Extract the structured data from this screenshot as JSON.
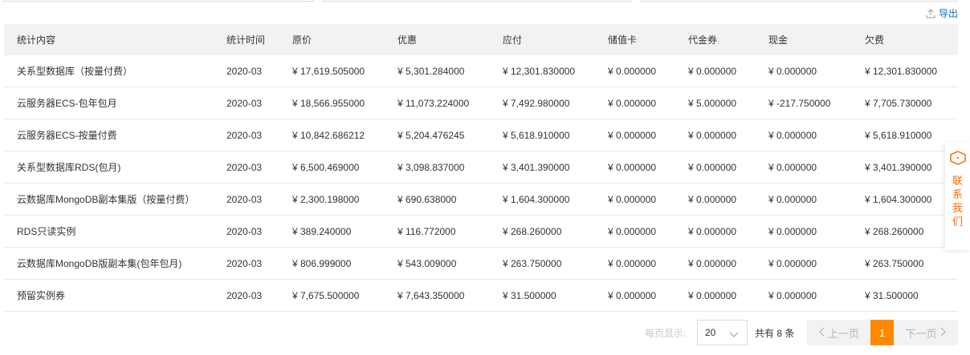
{
  "toolbar": {
    "export_label": "导出"
  },
  "table": {
    "headers": [
      "统计内容",
      "统计时间",
      "原价",
      "优惠",
      "应付",
      "储值卡",
      "代金券",
      "现金",
      "欠费"
    ],
    "rows": [
      [
        "关系型数据库（按量付费）",
        "2020-03",
        "¥ 17,619.505000",
        "¥ 5,301.284000",
        "¥ 12,301.830000",
        "¥ 0.000000",
        "¥ 0.000000",
        "¥ 0.000000",
        "¥ 12,301.830000"
      ],
      [
        "云服务器ECS-包年包月",
        "2020-03",
        "¥ 18,566.955000",
        "¥ 11,073.224000",
        "¥ 7,492.980000",
        "¥ 0.000000",
        "¥ 5.000000",
        "¥ -217.750000",
        "¥ 7,705.730000"
      ],
      [
        "云服务器ECS-按量付费",
        "2020-03",
        "¥ 10,842.686212",
        "¥ 5,204.476245",
        "¥ 5,618.910000",
        "¥ 0.000000",
        "¥ 0.000000",
        "¥ 0.000000",
        "¥ 5,618.910000"
      ],
      [
        "关系型数据库RDS(包月)",
        "2020-03",
        "¥ 6,500.469000",
        "¥ 3,098.837000",
        "¥ 3,401.390000",
        "¥ 0.000000",
        "¥ 0.000000",
        "¥ 0.000000",
        "¥ 3,401.390000"
      ],
      [
        "云数据库MongoDB副本集版（按量付费）",
        "2020-03",
        "¥ 2,300.198000",
        "¥ 690.638000",
        "¥ 1,604.300000",
        "¥ 0.000000",
        "¥ 0.000000",
        "¥ 0.000000",
        "¥ 1,604.300000"
      ],
      [
        "RDS只读实例",
        "2020-03",
        "¥ 389.240000",
        "¥ 116.772000",
        "¥ 268.260000",
        "¥ 0.000000",
        "¥ 0.000000",
        "¥ 0.000000",
        "¥ 268.260000"
      ],
      [
        "云数据库MongoDB版副本集(包年包月)",
        "2020-03",
        "¥ 806.999000",
        "¥ 543.009000",
        "¥ 263.750000",
        "¥ 0.000000",
        "¥ 0.000000",
        "¥ 0.000000",
        "¥ 263.750000"
      ],
      [
        "预留实例券",
        "2020-03",
        "¥ 7,675.500000",
        "¥ 7,643.350000",
        "¥ 31.500000",
        "¥ 0.000000",
        "¥ 0.000000",
        "¥ 0.000000",
        "¥ 31.500000"
      ]
    ]
  },
  "pagination": {
    "page_size_label": "每页显示:",
    "page_size": "20",
    "total": "共有 8 条",
    "prev_label": "上一页",
    "current_page": "1",
    "next_label": "下一页"
  },
  "contact": {
    "label": "联系我们"
  },
  "colors": {
    "accent": "#ff8a00",
    "link": "#0070cc",
    "contact": "#ff6a00"
  }
}
